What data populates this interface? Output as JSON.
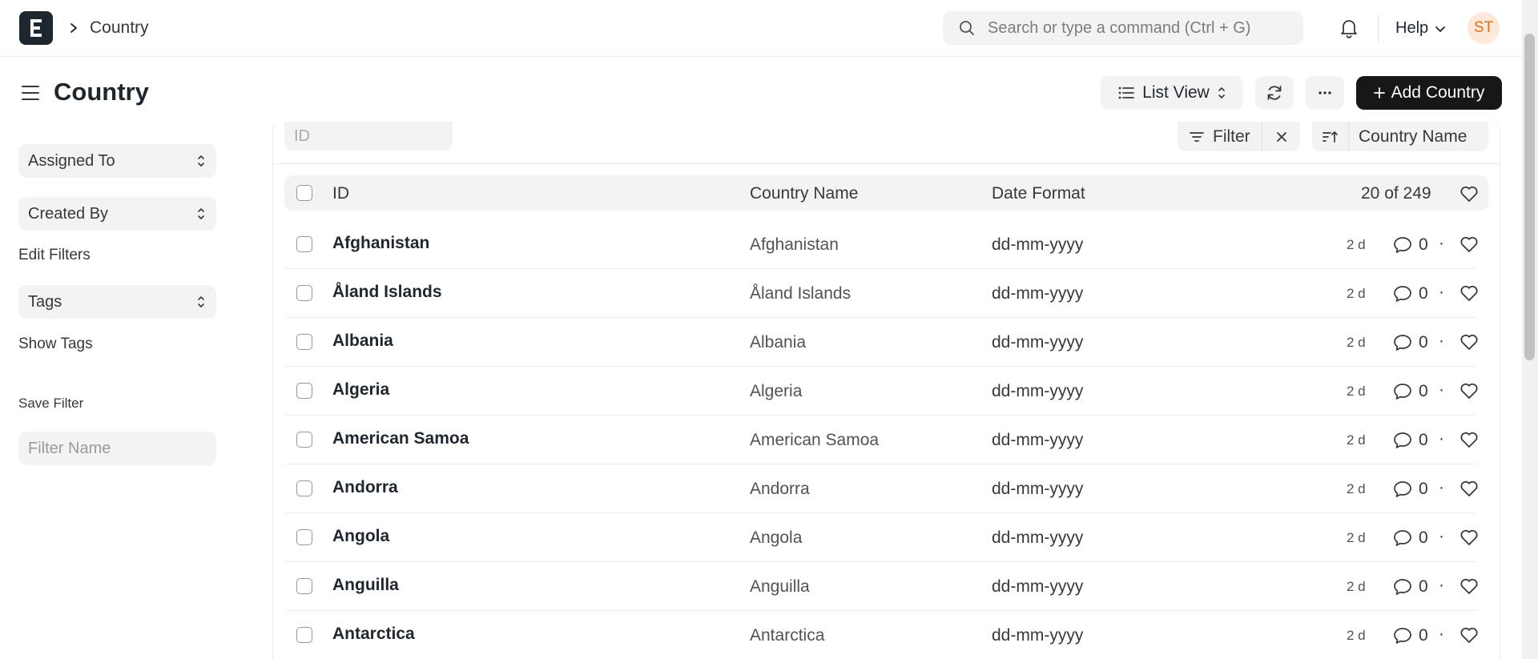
{
  "navbar": {
    "breadcrumb": "Country",
    "search_placeholder": "Search or type a command (Ctrl + G)",
    "help_label": "Help",
    "avatar_initials": "ST"
  },
  "page": {
    "title": "Country",
    "list_view_label": "List View",
    "add_button_label": "Add Country"
  },
  "sidebar": {
    "assigned_to": "Assigned To",
    "created_by": "Created By",
    "edit_filters": "Edit Filters",
    "tags": "Tags",
    "show_tags": "Show Tags",
    "save_filter": "Save Filter",
    "filter_name_placeholder": "Filter Name"
  },
  "filters": {
    "id_placeholder": "ID",
    "filter_label": "Filter",
    "sort_label": "Country Name"
  },
  "table": {
    "columns": [
      "ID",
      "Country Name",
      "Date Format"
    ],
    "count_label": "20 of 249",
    "rows": [
      {
        "id": "Afghanistan",
        "name": "Afghanistan",
        "format": "dd-mm-yyyy",
        "modified": "2 d",
        "comments": "0"
      },
      {
        "id": "Åland Islands",
        "name": "Åland Islands",
        "format": "dd-mm-yyyy",
        "modified": "2 d",
        "comments": "0"
      },
      {
        "id": "Albania",
        "name": "Albania",
        "format": "dd-mm-yyyy",
        "modified": "2 d",
        "comments": "0"
      },
      {
        "id": "Algeria",
        "name": "Algeria",
        "format": "dd-mm-yyyy",
        "modified": "2 d",
        "comments": "0"
      },
      {
        "id": "American Samoa",
        "name": "American Samoa",
        "format": "dd-mm-yyyy",
        "modified": "2 d",
        "comments": "0"
      },
      {
        "id": "Andorra",
        "name": "Andorra",
        "format": "dd-mm-yyyy",
        "modified": "2 d",
        "comments": "0"
      },
      {
        "id": "Angola",
        "name": "Angola",
        "format": "dd-mm-yyyy",
        "modified": "2 d",
        "comments": "0"
      },
      {
        "id": "Anguilla",
        "name": "Anguilla",
        "format": "dd-mm-yyyy",
        "modified": "2 d",
        "comments": "0"
      },
      {
        "id": "Antarctica",
        "name": "Antarctica",
        "format": "dd-mm-yyyy",
        "modified": "2 d",
        "comments": "0"
      }
    ],
    "separator": "·"
  },
  "icons": {
    "logo": "frappe-logo-icon",
    "breadcrumb": "chevron-right-icon",
    "search": "search-icon",
    "notifications": "bell-icon",
    "help": "chevron-down-icon",
    "sidebar_toggle": "hamburger-icon",
    "list_view": "list-icon",
    "refresh": "refresh-icon",
    "more": "more-horizontal-icon",
    "add": "plus-icon",
    "select": "select-arrows-icon",
    "filter": "filter-icon",
    "clear": "close-icon",
    "sort": "sort-ascending-icon",
    "like": "heart-icon",
    "comment": "comment-icon"
  },
  "colors": {
    "primary_button": "#171717",
    "avatar_bg": "#fde8da",
    "avatar_text": "#e2711d",
    "control_bg": "#f3f3f3"
  }
}
